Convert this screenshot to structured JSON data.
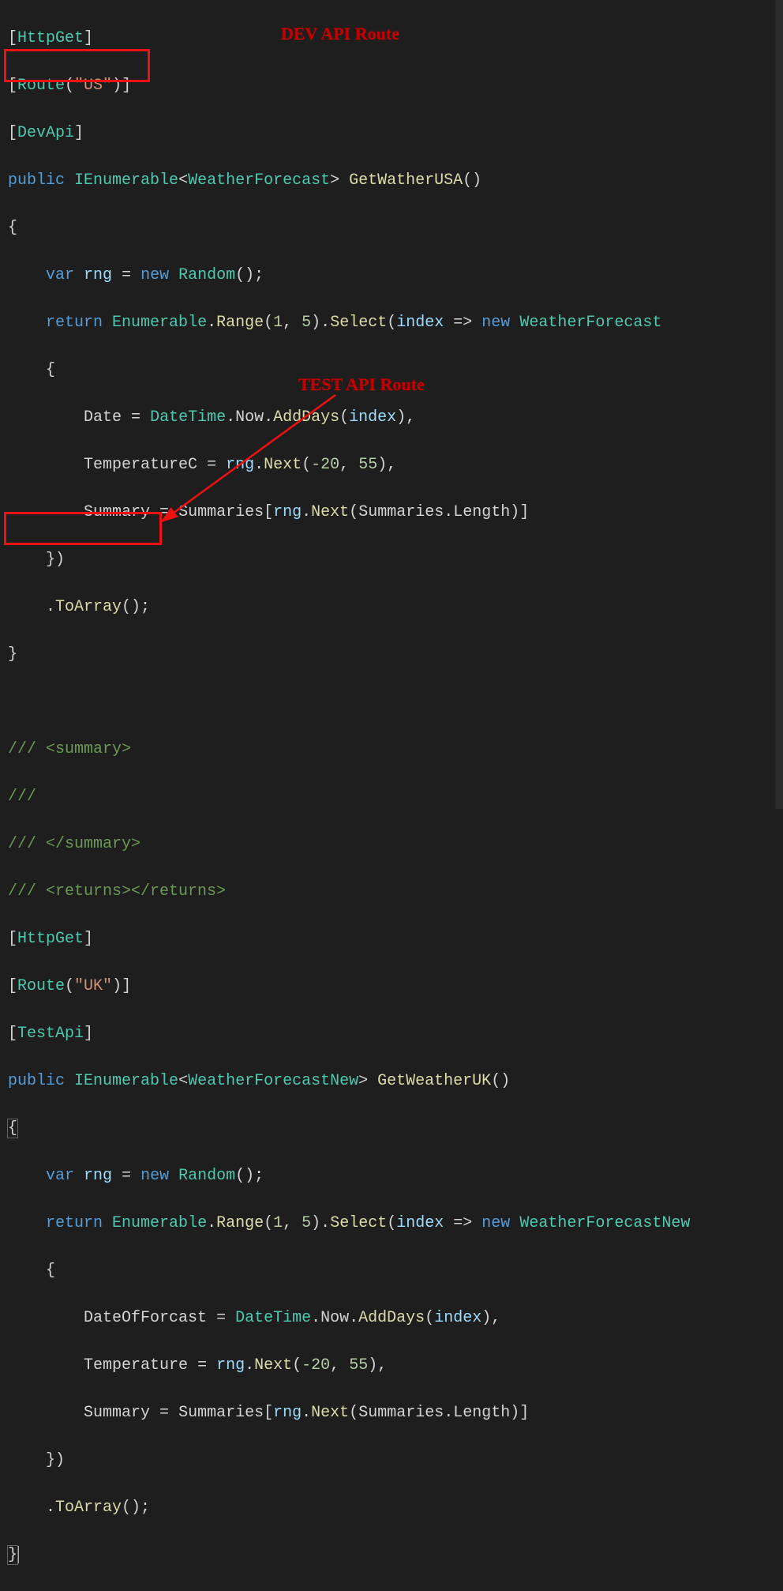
{
  "annotations": {
    "dev": "DEV API Route",
    "test": "TEST API Route"
  },
  "code": {
    "attr_httpget": "HttpGet",
    "attr_route": "Route",
    "route_us": "\"US\"",
    "route_uk": "\"UK\"",
    "attr_devapi": "DevApi",
    "attr_testapi": "TestApi",
    "kw_public": "public",
    "type_ienum": "IEnumerable",
    "type_wf": "WeatherForecast",
    "type_wfnew": "WeatherForecastNew",
    "method_getusa": "GetWatherUSA",
    "method_getuk": "GetWeatherUK",
    "kw_var": "var",
    "var_rng": "rng",
    "kw_new": "new",
    "type_random": "Random",
    "kw_return": "return",
    "type_enumerable": "Enumerable",
    "method_range": "Range",
    "num_1": "1",
    "num_5": "5",
    "method_select": "Select",
    "var_index": "index",
    "arrow": "=>",
    "prop_date": "Date",
    "prop_dateof": "DateOfForcast",
    "type_datetime": "DateTime",
    "prop_now": "Now",
    "method_adddays": "AddDays",
    "prop_tempc": "TemperatureC",
    "prop_temp": "Temperature",
    "method_next": "Next",
    "num_neg20": "-20",
    "num_55": "55",
    "prop_summary": "Summary",
    "prop_summaries": "Summaries",
    "prop_length": "Length",
    "method_toarray": "ToArray",
    "xml_summary_open": "/// <summary>",
    "xml_empty": "///",
    "xml_summary_close": "/// </summary>",
    "xml_returns": "/// <returns></returns>"
  }
}
